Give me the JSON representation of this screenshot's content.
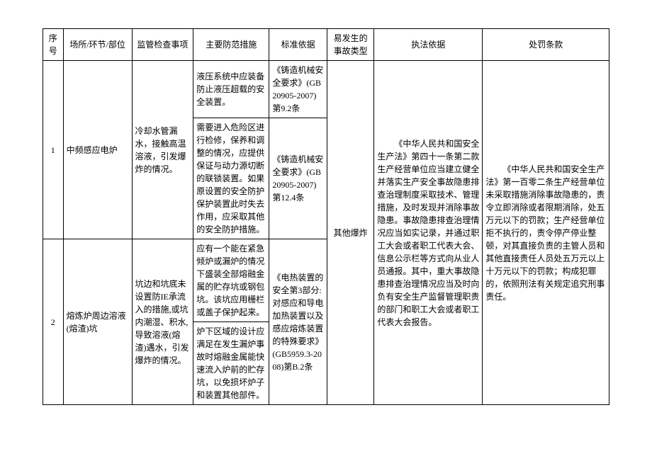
{
  "headers": {
    "seq": "序号",
    "place": "场所/环节/部位",
    "check": "监管检查事项",
    "measure": "主要防范措施",
    "standard": "标准依据",
    "accident": "易发生的事故类型",
    "law": "执法依据",
    "penalty": "处罚条款"
  },
  "rows": {
    "r1": {
      "seq": "1",
      "place": "中频感应电炉",
      "check": "冷却水管漏水，接触高温溶液，引发爆炸的情况。",
      "measure1": "液压系统中应装备防止液压超载的安全装置。",
      "standard1": "《铸造机械安全要求》(GB20905-2007)第9.2条",
      "measure2": "需要进入危险区进行检修，保养和调整的情况，应提供保证与动力源切断的联锁装置。如果原设置的安全防护保护装置此时失去作用，应采取其他的安全防护措施。",
      "standard2": "《铸造机械安全要求》(GB20905-2007)第12.4条"
    },
    "r2": {
      "seq": "2",
      "place": "熔炼炉周边溶液(熔渣)坑",
      "check": "坑边和坑底未设置防IE承流入的措施,或坑内潮湿、积水,导致溶液(熔渣)遇水，引发爆炸的情况。",
      "measure1": "应有一个能在紧急倾炉或漏炉的情况下盛装全部熔融金属的贮存坑或钢包坑。该坑应用栅栏或盖子保护起来。",
      "measure2": "炉下区域的设计应满足在发生漏炉事故时熔融金属能快速流入炉前的贮存坑，以免损坏炉子和装置其他部件。",
      "standard": "《电热装置的安全第3部分:对感应和导电加热装置以及感应熔炼装置的特殊要求》(GB5959.3-2008)第B.2条"
    },
    "shared": {
      "accident": "其他爆炸",
      "law": "《中华人民共和国安全生产法》第四十一条第二款生产经营单位应当建立健全并落实生产安全事故隐患排查治理制度采取技术、管理措施，及时发现并消除事故隐患。事故隐患排查治理情况应当如实记录，并通过职工大会或者职工代表大会、信息公示栏等方式向从业人员通报。其中，重大事故隐患排查治理情况应当及时向负有安全生产监督管理职责的部门和职工大会或者职工代表大会报告。",
      "penalty": "《中华人民共和国安全生产法》第一百零二条生产经营单位未采取措施消除事故隐患的，责令立即消除或者限期消除，处五万元以下的罚款；生产经营单位拒不执行的，责令停产停业整顿，对其直接负责的主管人员和其他直接责任人员处五万元以上十万元以下的罚款；构成犯罪的，依照刑法有关规定追究刑事责任。"
    }
  }
}
